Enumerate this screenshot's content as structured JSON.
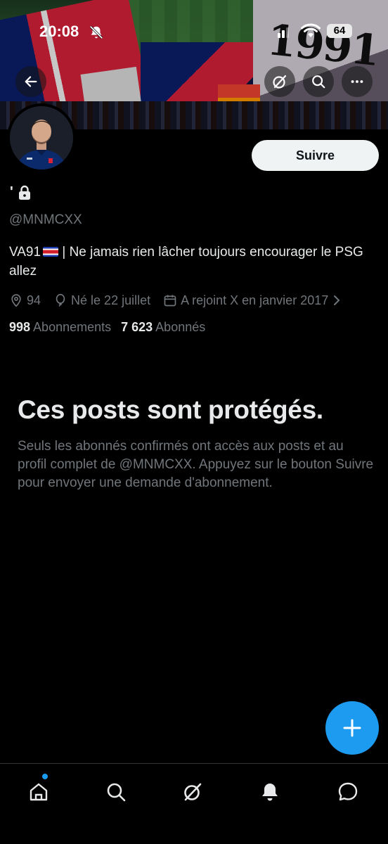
{
  "status_bar": {
    "time": "20:08",
    "battery": "64"
  },
  "header": {
    "back_icon": "arrow-left-icon",
    "actions": [
      "grok-icon",
      "search-icon",
      "more-icon"
    ]
  },
  "profile": {
    "display_name": "'",
    "protected_icon": "lock-icon",
    "handle": "@MNMCXX",
    "follow_label": "Suivre",
    "bio_prefix": "VA91",
    "bio_suffix": " | Ne jamais rien lâcher toujours encourager le PSG allez",
    "location": "94",
    "birthday": "Né le 22 juillet",
    "joined": "A rejoint X en janvier 2017",
    "following_count": "998",
    "following_label": "Abonnements",
    "followers_count": "7 623",
    "followers_label": "Abonnés"
  },
  "protected_notice": {
    "title": "Ces posts sont protégés.",
    "text": "Seuls les abonnés confirmés ont accès aux posts et au profil complet de @MNMCXX. Appuyez sur le bouton Suivre pour envoyer une demande d'abonnement."
  },
  "fab": {
    "icon": "plus-icon"
  },
  "tabbar": {
    "items": [
      "home-icon",
      "search-icon",
      "grok-icon",
      "bell-icon",
      "messages-icon"
    ],
    "home_has_notification": true
  },
  "colors": {
    "accent": "#1d9bf0",
    "text": "#e7e9ea",
    "secondary": "#71767b",
    "background": "#000000"
  }
}
